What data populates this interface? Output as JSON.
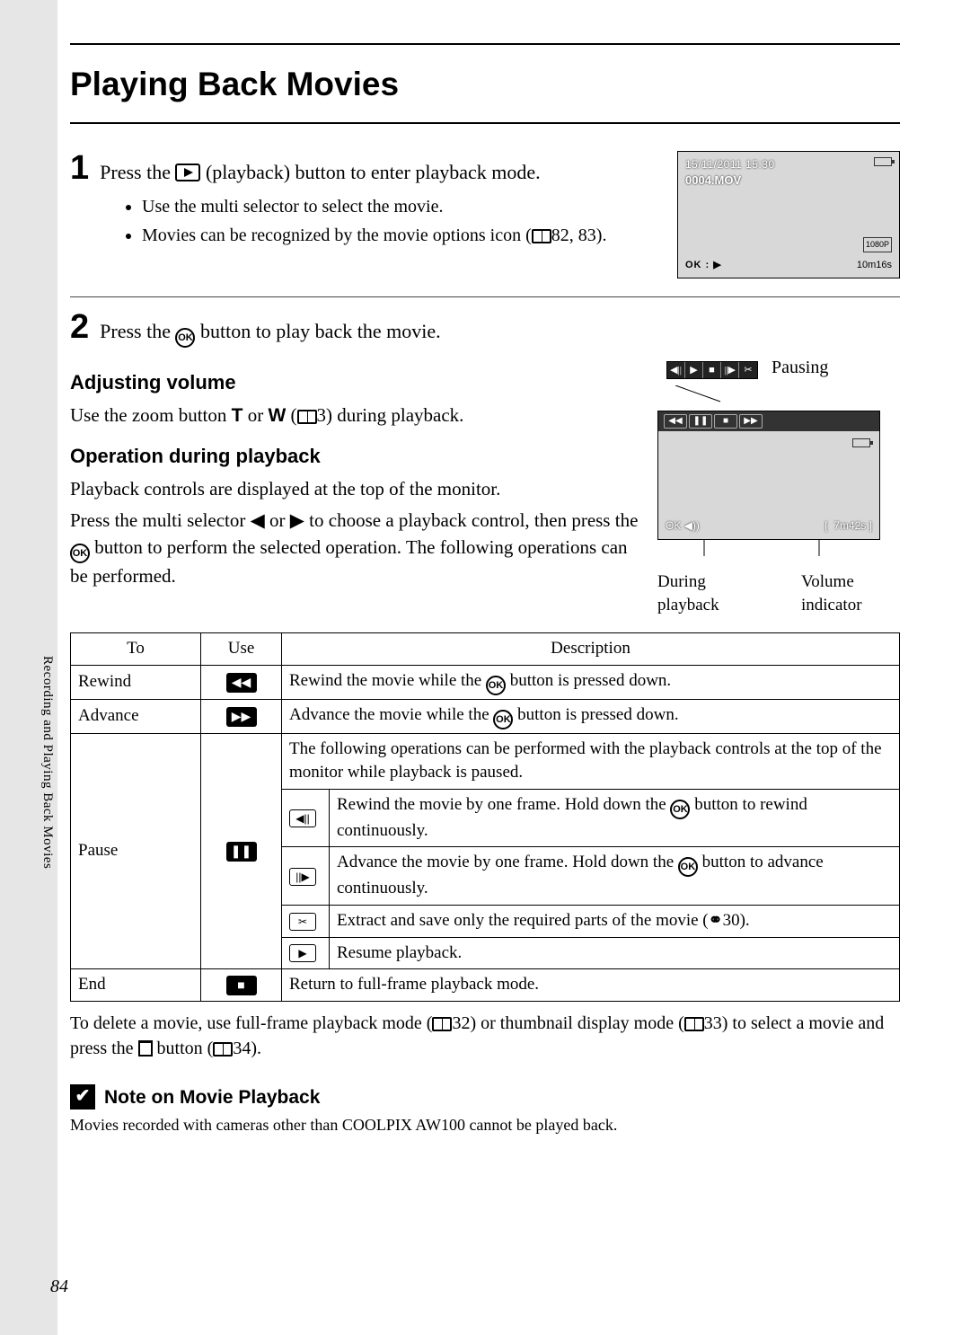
{
  "heading": "Playing Back Movies",
  "side_label": "Recording and Playing Back Movies",
  "page_number": "84",
  "step1": {
    "num": "1",
    "title_a": "Press the ",
    "title_b": " (playback) button to enter playback mode.",
    "bullet1": "Use the multi selector to select the movie.",
    "bullet2_a": "Movies can be recognized by the movie options icon (",
    "bullet2_b": "82, 83)."
  },
  "cam1": {
    "date": "15/11/2011 15:30",
    "file": "0004.MOV",
    "res": "1080P",
    "ok_label": "OK : ▶",
    "duration": "10m16s"
  },
  "step2": {
    "num": "2",
    "title_a": "Press the ",
    "title_b": " button to play back the movie.",
    "sub_vol": "Adjusting volume",
    "vol_text_a": "Use the zoom button ",
    "vol_T": "T",
    "vol_or": " or ",
    "vol_W": "W",
    "vol_text_b": " (",
    "vol_text_c": "3) during playback.",
    "sub_op": "Operation during playback",
    "op_p1": "Playback controls are displayed at the top of the monitor.",
    "op_p2": "Press the multi selector ◀ or ▶ to choose a playback control, then press the ",
    "op_p3": " button to perform the selected operation. The following operations can be performed."
  },
  "toolbar_label": "Pausing",
  "cam2": {
    "time": "7m42s",
    "annot_left": "During playback",
    "annot_right": "Volume indicator"
  },
  "table": {
    "h_to": "To",
    "h_use": "Use",
    "h_desc": "Description",
    "rewind": {
      "to": "Rewind",
      "desc_a": "Rewind the movie while the ",
      "desc_b": " button is pressed down."
    },
    "advance": {
      "to": "Advance",
      "desc_a": "Advance the movie while the ",
      "desc_b": " button is pressed down."
    },
    "pause": {
      "to": "Pause",
      "intro": "The following operations can be performed with the playback controls at the top of the monitor while playback is paused.",
      "fr_rew_a": "Rewind the movie by one frame. Hold down the ",
      "fr_rew_b": " button to rewind continuously.",
      "fr_adv_a": "Advance the movie by one frame. Hold down the ",
      "fr_adv_b": " button to advance continuously.",
      "extract_a": "Extract and save only the required parts of the movie (",
      "extract_b": "30).",
      "resume": "Resume playback."
    },
    "end": {
      "to": "End",
      "desc": "Return to full-frame playback mode."
    }
  },
  "after_table": {
    "a": "To delete a movie, use full-frame playback mode (",
    "b": "32) or thumbnail display mode (",
    "c": "33) to select a movie and press the ",
    "d": " button (",
    "e": "34)."
  },
  "note": {
    "head": "Note on Movie Playback",
    "body": "Movies recorded with cameras other than COOLPIX AW100 cannot be played back."
  }
}
